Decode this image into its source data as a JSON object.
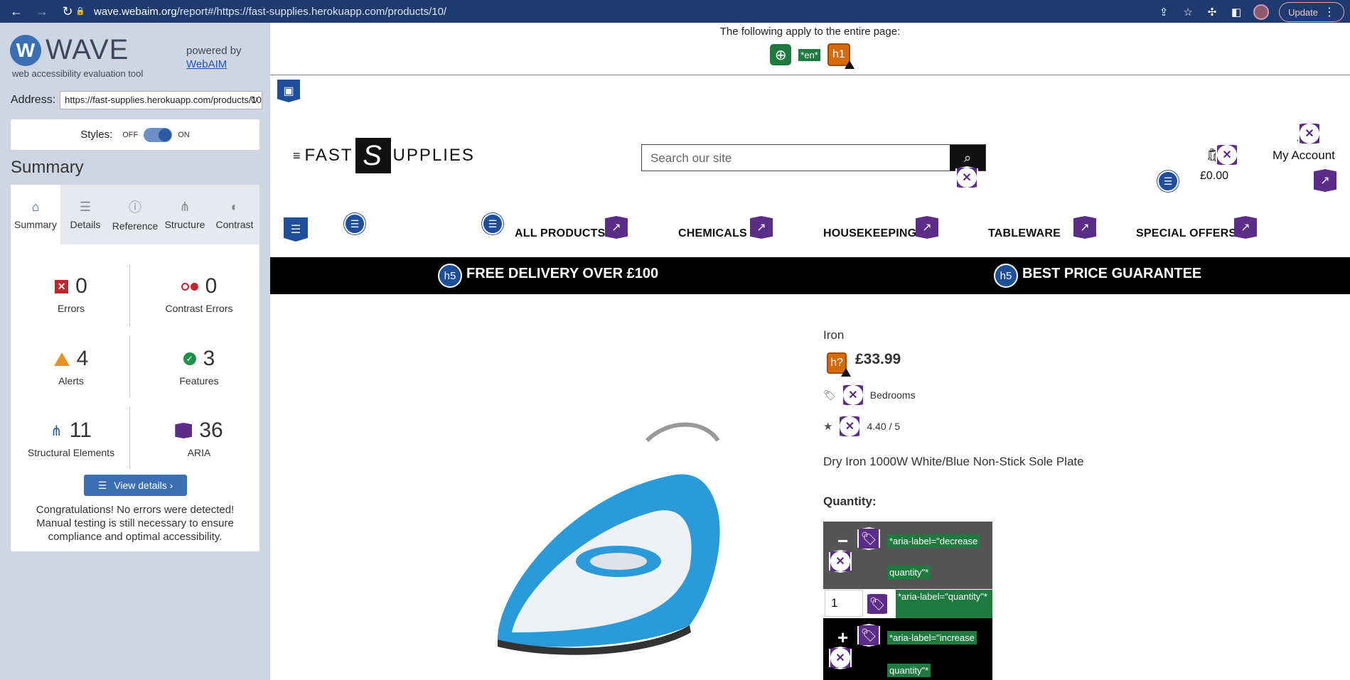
{
  "browser": {
    "back": "←",
    "forward": "→",
    "reload": "↻",
    "url_host": "wave.webaim.org",
    "url_path": "/report#/https://fast-supplies.herokuapp.com/products/10/",
    "update_label": "Update"
  },
  "wave": {
    "logo_letter": "W",
    "logo_name": "WAVE",
    "subtitle": "web accessibility evaluation tool",
    "powered_by": "powered by",
    "webaim_link": "WebAIM",
    "address_label": "Address:",
    "address_value": "https://fast-supplies.herokuapp.com/products/10/",
    "styles_label": "Styles:",
    "styles_off": "OFF",
    "styles_on": "ON",
    "summary_title": "Summary",
    "tabs": [
      {
        "label": "Summary",
        "icon": "home-icon"
      },
      {
        "label": "Details",
        "icon": "list-icon"
      },
      {
        "label": "Reference",
        "icon": "info-icon"
      },
      {
        "label": "Structure",
        "icon": "structure-icon"
      },
      {
        "label": "Contrast",
        "icon": "contrast-icon"
      }
    ],
    "stats": {
      "errors": {
        "value": "0",
        "label": "Errors"
      },
      "contrast": {
        "value": "0",
        "label": "Contrast Errors"
      },
      "alerts": {
        "value": "4",
        "label": "Alerts"
      },
      "features": {
        "value": "3",
        "label": "Features"
      },
      "structural": {
        "value": "11",
        "label": "Structural Elements"
      },
      "aria": {
        "value": "36",
        "label": "ARIA"
      }
    },
    "view_details": "View details ›",
    "congrats": "Congratulations! No errors were detected! Manual testing is still necessary to ensure compliance and optimal accessibility."
  },
  "page": {
    "applies_text": "The following apply to the entire page:",
    "lang_tag": "*en*",
    "h1_tag": "h1",
    "logo_left": "FAST",
    "logo_s": "S",
    "logo_right": "UPPLIES",
    "search_placeholder": "Search our site",
    "cart_amount": "£0.00",
    "account_label": "My Account",
    "menu": [
      "ALL PRODUCTS",
      "CHEMICALS",
      "HOUSEKEEPING",
      "TABLEWARE",
      "SPECIAL OFFERS"
    ],
    "banner": [
      "FREE DELIVERY OVER £100",
      "BEST PRICE GUARANTEE"
    ],
    "h5_tag": "h5",
    "h_unknown_tag": "h?",
    "product": {
      "name": "Iron",
      "price": "£33.99",
      "category": "Bedrooms",
      "rating": "4.40 / 5",
      "description": "Dry Iron 1000W White/Blue Non-Stick Sole Plate",
      "quantity_label": "Quantity:",
      "quantity_value": "1",
      "decrease": "−",
      "increase": "+",
      "aria_decrease_1": "*aria-label=\"decrease",
      "aria_decrease_2": "quantity\"*",
      "aria_quantity": "*aria-label=\"quantity\"*",
      "aria_increase_1": "*aria-label=\"increase",
      "aria_increase_2": "quantity\"*"
    }
  }
}
